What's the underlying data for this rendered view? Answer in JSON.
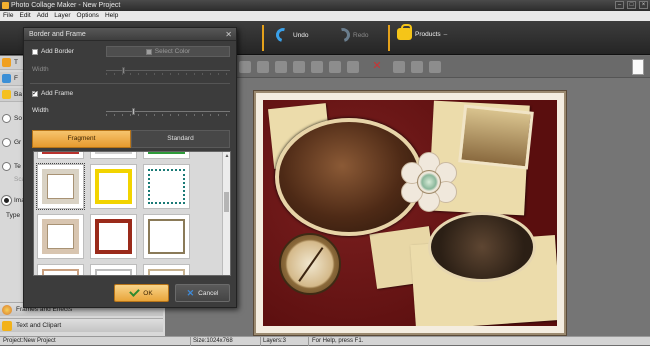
{
  "window": {
    "title": "Photo Collage Maker - New Project"
  },
  "menu": [
    "File",
    "Edit",
    "Add",
    "Layer",
    "Options",
    "Help"
  ],
  "toolbar": {
    "partial_label": "t",
    "undo_label": "Undo",
    "redo_label": "Redo",
    "products_label": "Products",
    "accent_color": "#e4a11b"
  },
  "left_panel": {
    "rows": [
      "T",
      "F",
      "Ba",
      "So",
      "Gr",
      "Te",
      "Scale",
      "Ima",
      "Type"
    ],
    "bottom_items": [
      {
        "label": "Frames and Effects",
        "icon": "frames-effects-icon"
      },
      {
        "label": "Text and Clipart",
        "icon": "text-clipart-icon"
      }
    ]
  },
  "dialog": {
    "title": "Border and Frame",
    "close_glyph": "✕",
    "add_border_label": "Add Border",
    "add_border_checked": false,
    "select_color_label": "Select Color",
    "border_width_label": "Width",
    "add_frame_label": "Add Frame",
    "add_frame_checked": true,
    "frame_width_label": "Width",
    "frame_width_value": 0.22,
    "tabs": [
      {
        "label": "Fragment",
        "active": true
      },
      {
        "label": "Standard",
        "active": false
      }
    ],
    "frame_thumbnails": [
      {
        "border": "#b8322e",
        "style": "thin"
      },
      {
        "border": "#cfcfcf",
        "style": "thin"
      },
      {
        "border": "#2e9b3a",
        "style": "thin"
      },
      {
        "border": "#d9d2c4",
        "style": "ornate"
      },
      {
        "border": "#f2d400",
        "style": "thick"
      },
      {
        "border": "#1a7a76",
        "style": "dotted"
      },
      {
        "border": "#d8c5b0",
        "style": "ornate"
      },
      {
        "border": "#9a2a1a",
        "style": "thick"
      },
      {
        "border": "#8a7a58",
        "style": "double"
      },
      {
        "border": "#c9a080",
        "style": "thin"
      },
      {
        "border": "#bdbdbd",
        "style": "thin"
      },
      {
        "border": "#c6b290",
        "style": "thin"
      }
    ],
    "ok_label": "OK",
    "cancel_label": "Cancel"
  },
  "status": {
    "project": "Project:New Project",
    "size": "Size:1024x768",
    "layers": "Layers:3",
    "help": "For Help, press F1."
  }
}
